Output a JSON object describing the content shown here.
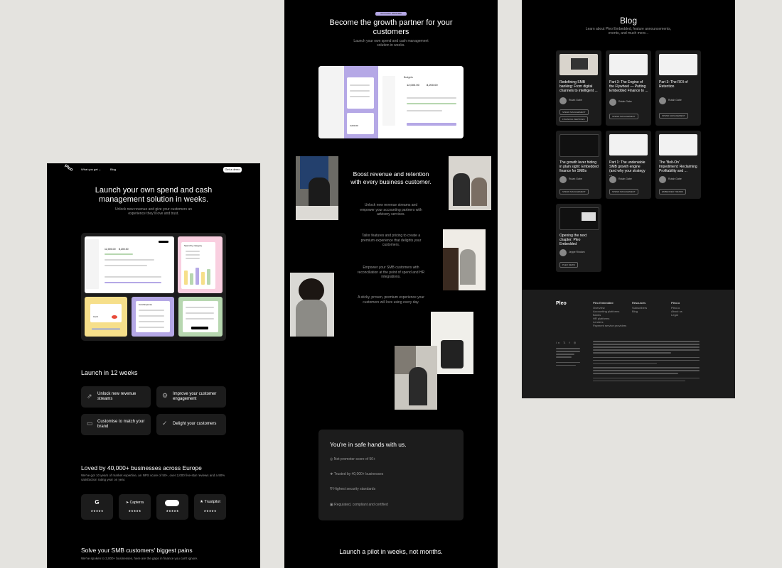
{
  "panel1": {
    "logo": "Pleo",
    "nav_what": "What you get",
    "nav_blog": "Blog",
    "nav_cta": "Get a demo",
    "hero_title": "Launch your own spend and cash management solution in weeks.",
    "hero_sub": "Unlock new revenue and give your customers an experience they'll love and trust.",
    "mock_budgets": "Budgets",
    "mock_v1": "12,000.00",
    "mock_v2": "8,200.00",
    "mock_category": "Spend by category",
    "mock_card": "Card",
    "mock_card_expense": "Card Expense",
    "launch_heading": "Launch in 12 weeks",
    "features": [
      "Unlock new revenue streams",
      "Improve your customer engagement",
      "Customise to match your brand",
      "Delight your customers"
    ],
    "loved_heading": "Loved by 40,000+ businesses across Europe",
    "loved_sub": "We've got 10 years of market expertise, an NPS score of 50+, over 2,000 five-star reviews and a 90% satisfaction rating year on year.",
    "reviews": [
      "G",
      "Capterra",
      "",
      "Trustpilot"
    ],
    "stars": "★★★★★",
    "pains_heading": "Solve your SMB customers' biggest pains",
    "pains_sub": "We've spoken to 3,000+ businesses, here are the gaps in finance you can't ignore."
  },
  "panel2": {
    "badge": "ACCOUNT PARTNER",
    "title": "Become the growth partner for your customers",
    "sub": "Launch your own spend and cash management solution in weeks.",
    "mock_budgets": "Budgets",
    "mock_v1": "12,000.00",
    "mock_v2": "8,200.00",
    "mock_v3": "3,000.00",
    "boost_heading": "Boost revenue and retention with every business customer.",
    "boost_items": [
      "Unlock new revenue streams and empower your accounting partners with advisory services.",
      "Tailor features and pricing to create a premium experience that delights your customers.",
      "Empower your SMB customers with reconciliation at the point of spend and HR integrations.",
      "A sticky, proven, premium experience your customers will love using every day."
    ],
    "safe_heading": "You're in safe hands with us.",
    "safe_items": [
      "Net promoter score of 50+",
      "Trusted by 40,000+ businesses",
      "Highest security standards",
      "Regulated, compliant and certified"
    ],
    "pilot": "Launch a pilot in weeks, not months."
  },
  "panel3": {
    "blog_title": "Blog",
    "blog_sub": "Learn about Pleo Embedded, feature announcements, events, and much more...",
    "posts": [
      {
        "title": "Redefining SMB banking: From digital channels to intelligent ...",
        "author": "Rutah Gabe",
        "tag1": "SPEND MANAGEMENT",
        "tag2": "FINANCIAL SERVICES"
      },
      {
        "title": "Part 3: The Engine of the Flywheel — Putting Embedded Finance to ...",
        "author": "Rutah Gabe",
        "tag1": "SPEND MANAGEMENT",
        "tag2": ""
      },
      {
        "title": "Part 3: The ROI of Retention",
        "author": "Rutah Gabe",
        "tag1": "SPEND MANAGEMENT",
        "tag2": ""
      },
      {
        "title": "The growth lever hiding in plain sight: Embedded finance for SMBs",
        "author": "Rutah Gabe",
        "tag1": "SPEND MANAGEMENT",
        "tag2": ""
      },
      {
        "title": "Part 1: The undeniable SMB growth engine (and why your strategy ...",
        "author": "Rutah Gabe",
        "tag1": "SPEND MANAGEMENT",
        "tag2": ""
      },
      {
        "title": "The 'Bolt-On' Impediment: Reclaiming Profitability and ...",
        "author": "Rutah Gabe",
        "tag1": "EMBEDDED TRENDS",
        "tag2": ""
      },
      {
        "title": "Opening the next chapter: Pleo Embedded",
        "author": "Jeppe Rindom",
        "tag1": "PLEO NEWS",
        "tag2": ""
      }
    ],
    "footer_logo": "Pleo",
    "col1_title": "Pleo Embedded",
    "col1_items": [
      "Overview",
      "Accounting platforms",
      "Banks",
      "HR platforms",
      "Lenders",
      "Payment service providers"
    ],
    "col2_title": "Resources",
    "col2_items": [
      "Subscribers",
      "Blog"
    ],
    "col3_title": "Pleo.io",
    "col3_items": [
      "Pleo.io",
      "About us",
      "Legal"
    ]
  }
}
